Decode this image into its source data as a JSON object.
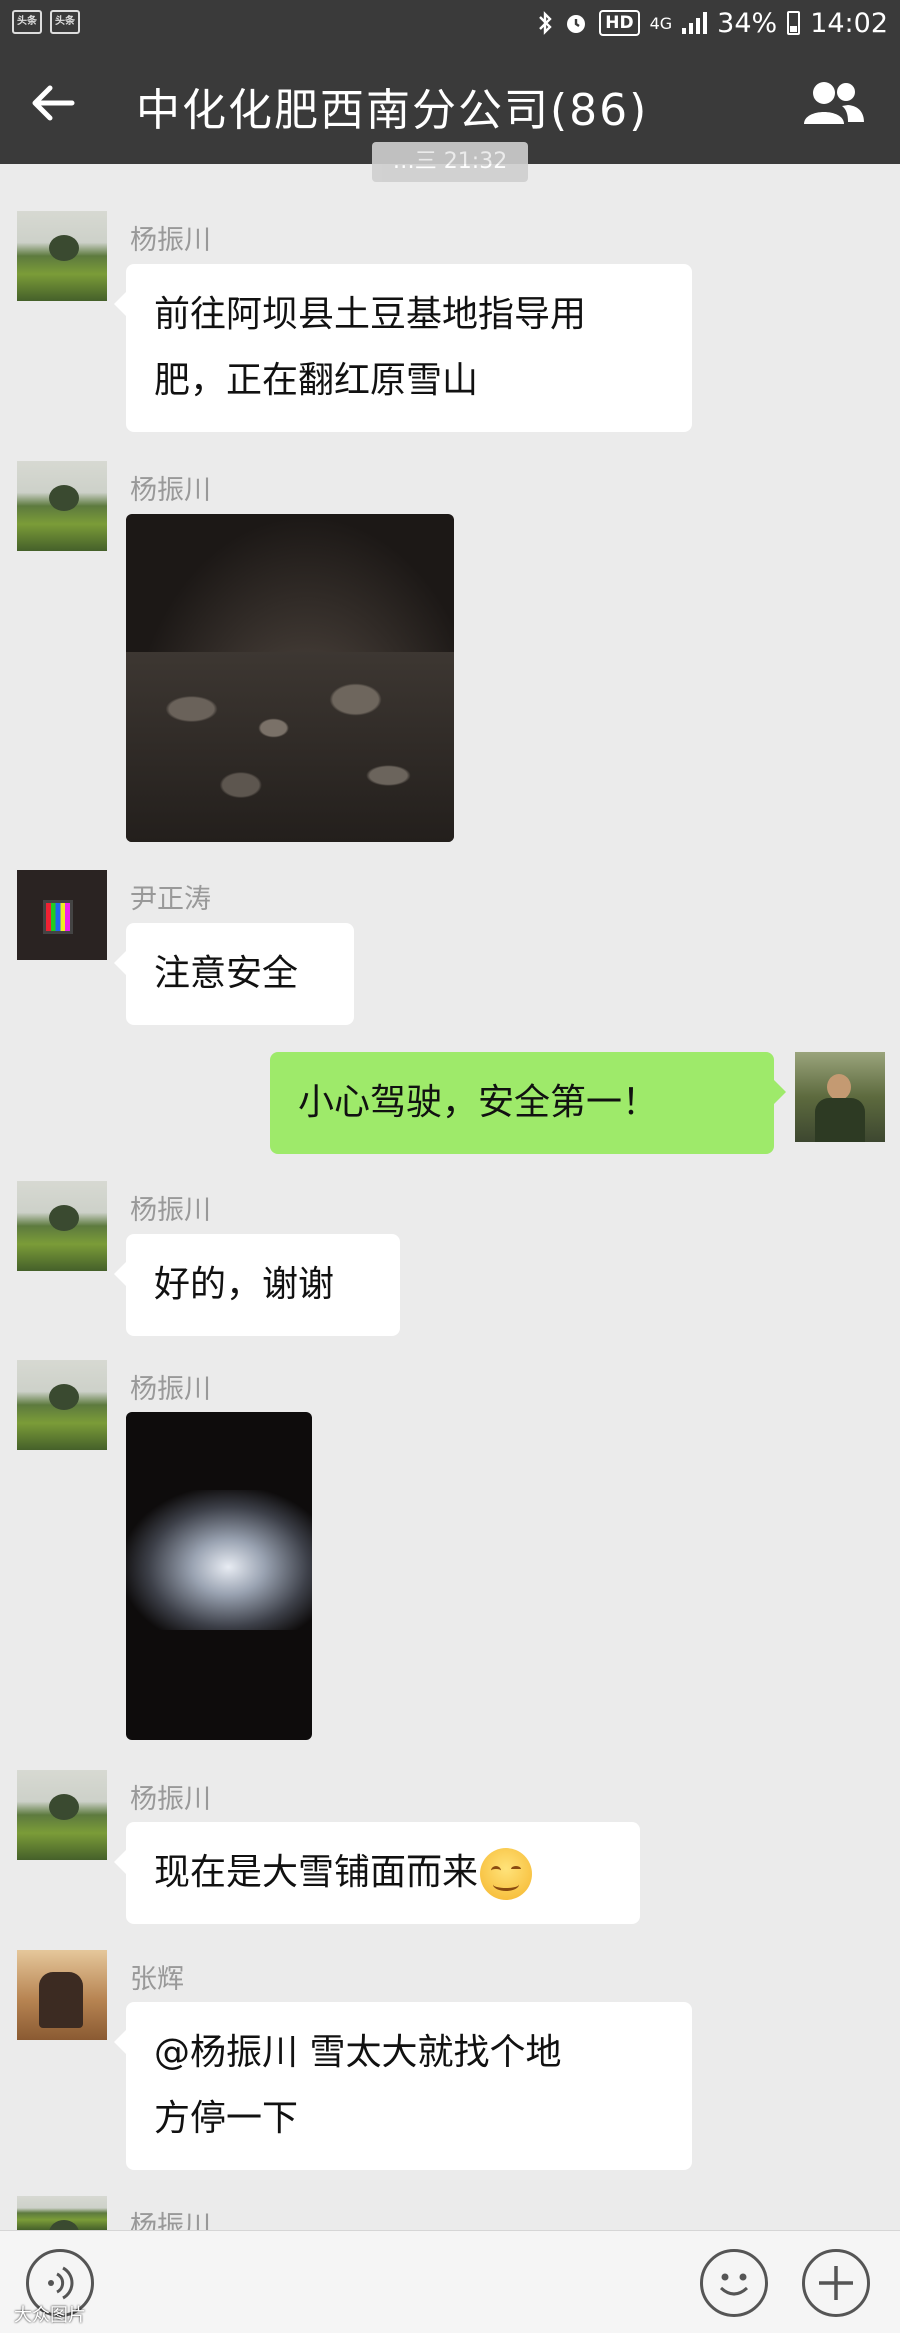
{
  "status_bar": {
    "app_icons": [
      "头条",
      "头条"
    ],
    "hd_label": "HD",
    "network_label": "4G",
    "battery": "34%",
    "time": "14:02"
  },
  "header": {
    "title": "中化化肥西南分公司(86)"
  },
  "time_divider": "…三 21:32",
  "messages": [
    {
      "sender": "杨振川",
      "text": "前往阿坝县土豆基地指导用",
      "text2": "肥，正在翻红原雪山"
    },
    {
      "sender": "杨振川",
      "type": "image"
    },
    {
      "sender": "尹正涛",
      "text": "注意安全"
    },
    {
      "sender": "me",
      "text": "小心驾驶，安全第一！"
    },
    {
      "sender": "杨振川",
      "text": "好的，谢谢"
    },
    {
      "sender": "杨振川",
      "type": "video"
    },
    {
      "sender": "杨振川",
      "text": "现在是大雪铺面而来",
      "emoji": "smiling-face-icon"
    },
    {
      "sender": "张辉",
      "text": "@杨振川  雪太大就找个地",
      "text2": "方停一下"
    },
    {
      "sender": "杨振川"
    }
  ],
  "watermark": "大众图片"
}
